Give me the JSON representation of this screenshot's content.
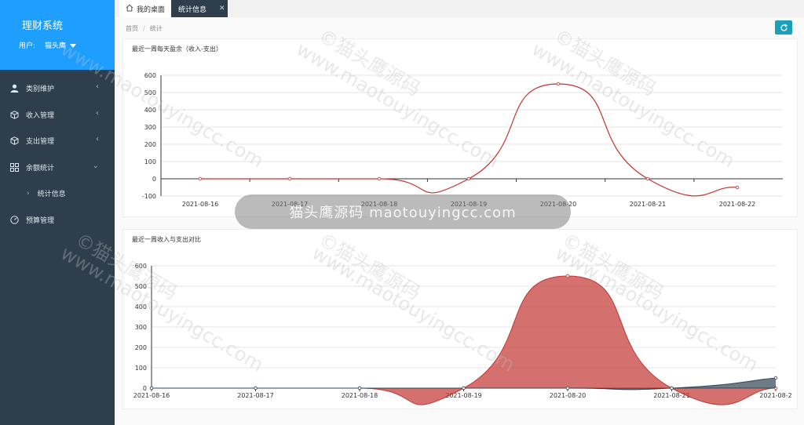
{
  "sidebar": {
    "title": "理财系统",
    "user_label": "用户:",
    "user_name": "猫头鹰",
    "items": [
      {
        "label": "类别维护",
        "icon": "user-icon",
        "expand": "‹"
      },
      {
        "label": "收入管理",
        "icon": "box-icon",
        "expand": "‹"
      },
      {
        "label": "支出管理",
        "icon": "box-icon",
        "expand": "‹"
      },
      {
        "label": "余额统计",
        "icon": "grid-icon",
        "expand": "⌄"
      },
      {
        "label": "统计信息",
        "icon": "chevron-right-icon",
        "sub": true
      },
      {
        "label": "预算管理",
        "icon": "gauge-icon"
      }
    ]
  },
  "tabs": [
    {
      "label": "我的桌面",
      "icon": "home-icon"
    },
    {
      "label": "统计信息",
      "close": "✕",
      "active": true
    }
  ],
  "breadcrumb": {
    "home": "首页",
    "separator": "/",
    "current": "统计"
  },
  "watermark": {
    "text": "www.maotouyingcc.com",
    "text_cn": "©猫头鹰源码",
    "banner": "猫头鹰源码 maotouyingcc.com"
  },
  "chart_data": [
    {
      "type": "line",
      "title": "最近一周每天盈余（收入-支出）",
      "categories": [
        "2021-08-16",
        "2021-08-17",
        "2021-08-18",
        "2021-08-19",
        "2021-08-20",
        "2021-08-21",
        "2021-08-22"
      ],
      "series": [
        {
          "values": [
            0,
            0,
            0,
            0,
            550,
            0,
            -50
          ],
          "color": "#c23531"
        }
      ],
      "ylim": [
        -100,
        600
      ],
      "yticks": [
        -100,
        0,
        100,
        200,
        300,
        400,
        500,
        600
      ],
      "smooth": true,
      "grid": true
    },
    {
      "type": "area",
      "title": "最近一周收入与支出对比",
      "categories": [
        "2021-08-16",
        "2021-08-17",
        "2021-08-18",
        "2021-08-19",
        "2021-08-20",
        "2021-08-21",
        "2021-08-2"
      ],
      "series": [
        {
          "values": [
            0,
            0,
            0,
            0,
            550,
            0,
            0
          ],
          "color": "#c23531"
        },
        {
          "values": [
            0,
            0,
            0,
            0,
            0,
            0,
            50
          ],
          "color": "#2f4554"
        }
      ],
      "ylim": [
        0,
        600
      ],
      "yticks": [
        0,
        100,
        200,
        300,
        400,
        500,
        600
      ],
      "smooth": true,
      "grid": true
    }
  ]
}
